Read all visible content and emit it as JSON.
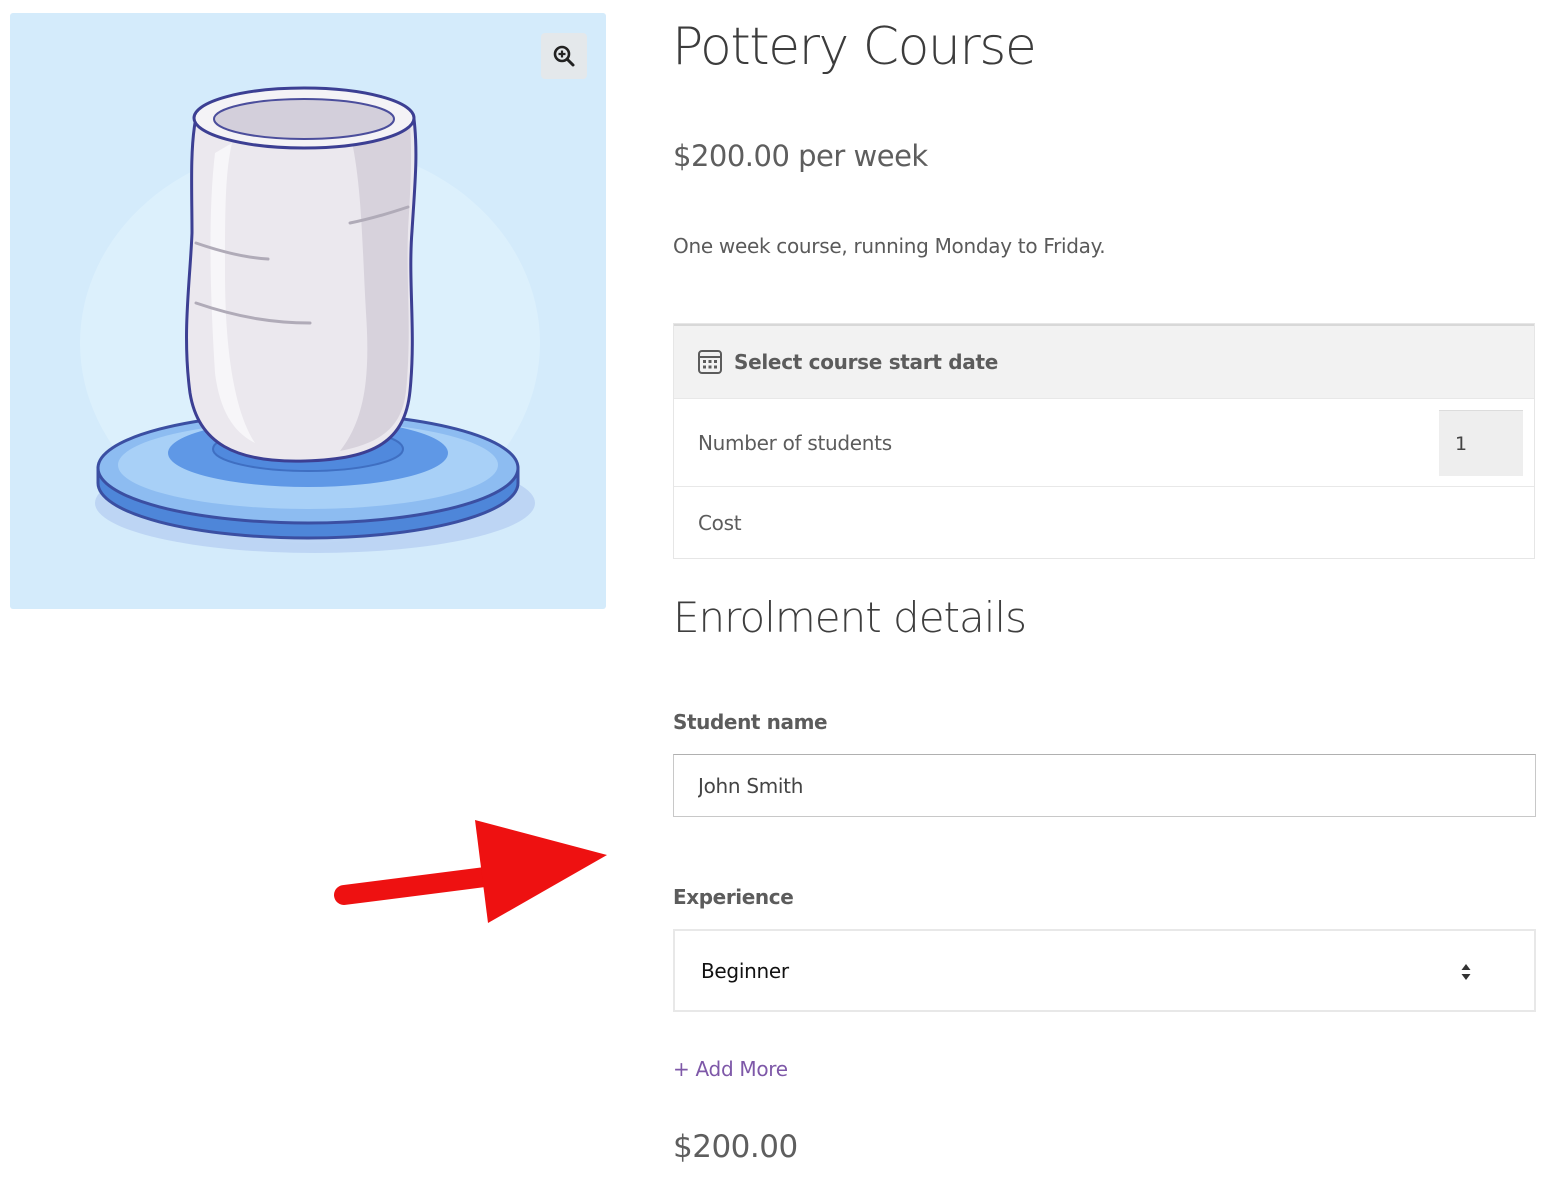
{
  "product": {
    "title": "Pottery Course",
    "price": "$200.00 per week",
    "description": "One week course, running Monday to Friday.",
    "image_icon": "pottery-vase-illustration",
    "zoom_icon": "zoom-in-icon"
  },
  "booking": {
    "date_label": "Select course start date",
    "date_icon": "calendar-icon",
    "students_label": "Number of students",
    "students_value": "1",
    "cost_label": "Cost"
  },
  "enrolment": {
    "heading": "Enrolment details",
    "student_name_label": "Student name",
    "student_name_value": "John Smith",
    "experience_label": "Experience",
    "experience_value": "Beginner",
    "add_more": "+ Add More",
    "total": "$200.00"
  },
  "colors": {
    "accent_link": "#7e58a8",
    "annotation_arrow": "#ee1111",
    "image_background": "#d4ebfb"
  }
}
